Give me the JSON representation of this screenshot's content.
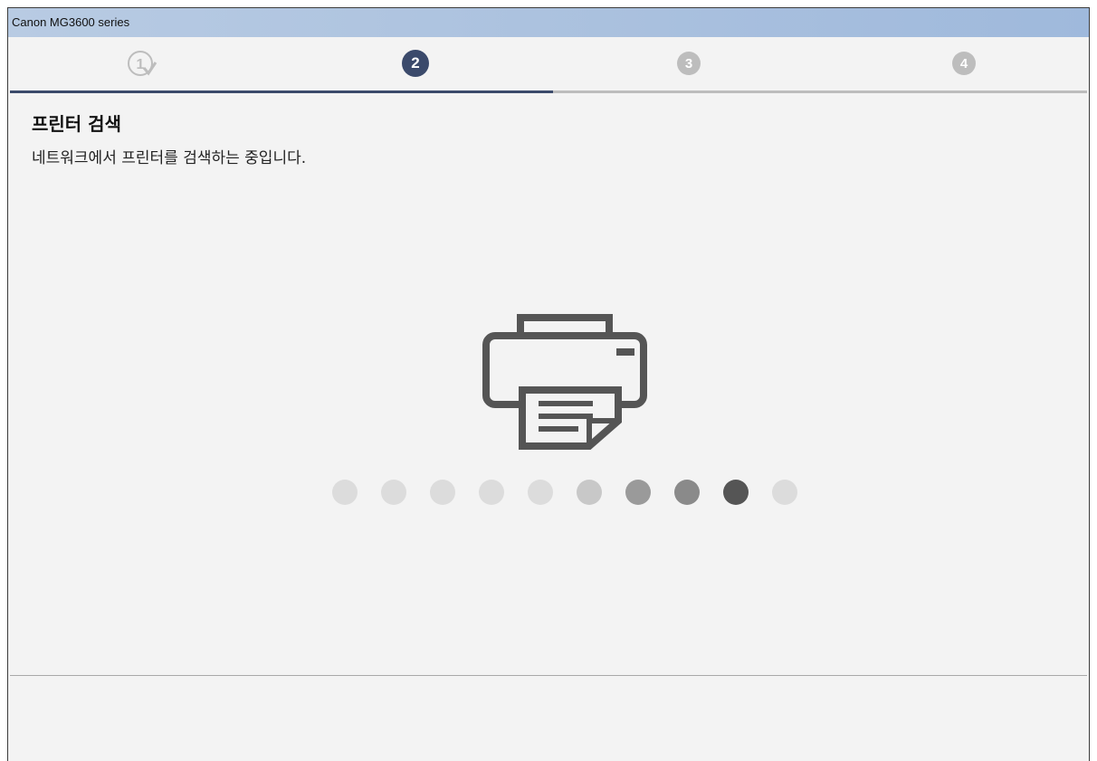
{
  "window": {
    "title": "Canon MG3600 series"
  },
  "steps": [
    {
      "label": "1",
      "state": "done"
    },
    {
      "label": "2",
      "state": "active"
    },
    {
      "label": "3",
      "state": "inactive"
    },
    {
      "label": "4",
      "state": "inactive"
    }
  ],
  "main": {
    "heading": "프린터 검색",
    "description": "네트워크에서 프린터를 검색하는 중입니다."
  },
  "icons": {
    "printer": "printer-icon",
    "step_done": "check-icon"
  },
  "loading": {
    "dot_colors": [
      "#dcdcdc",
      "#dcdcdc",
      "#dcdcdc",
      "#dcdcdc",
      "#dcdcdc",
      "#c8c8c8",
      "#9a9a9a",
      "#8a8a8a",
      "#555555",
      "#dcdcdc"
    ]
  },
  "colors": {
    "accent": "#3b4a6b",
    "inactive": "#bdbdbd",
    "icon": "#555555"
  }
}
